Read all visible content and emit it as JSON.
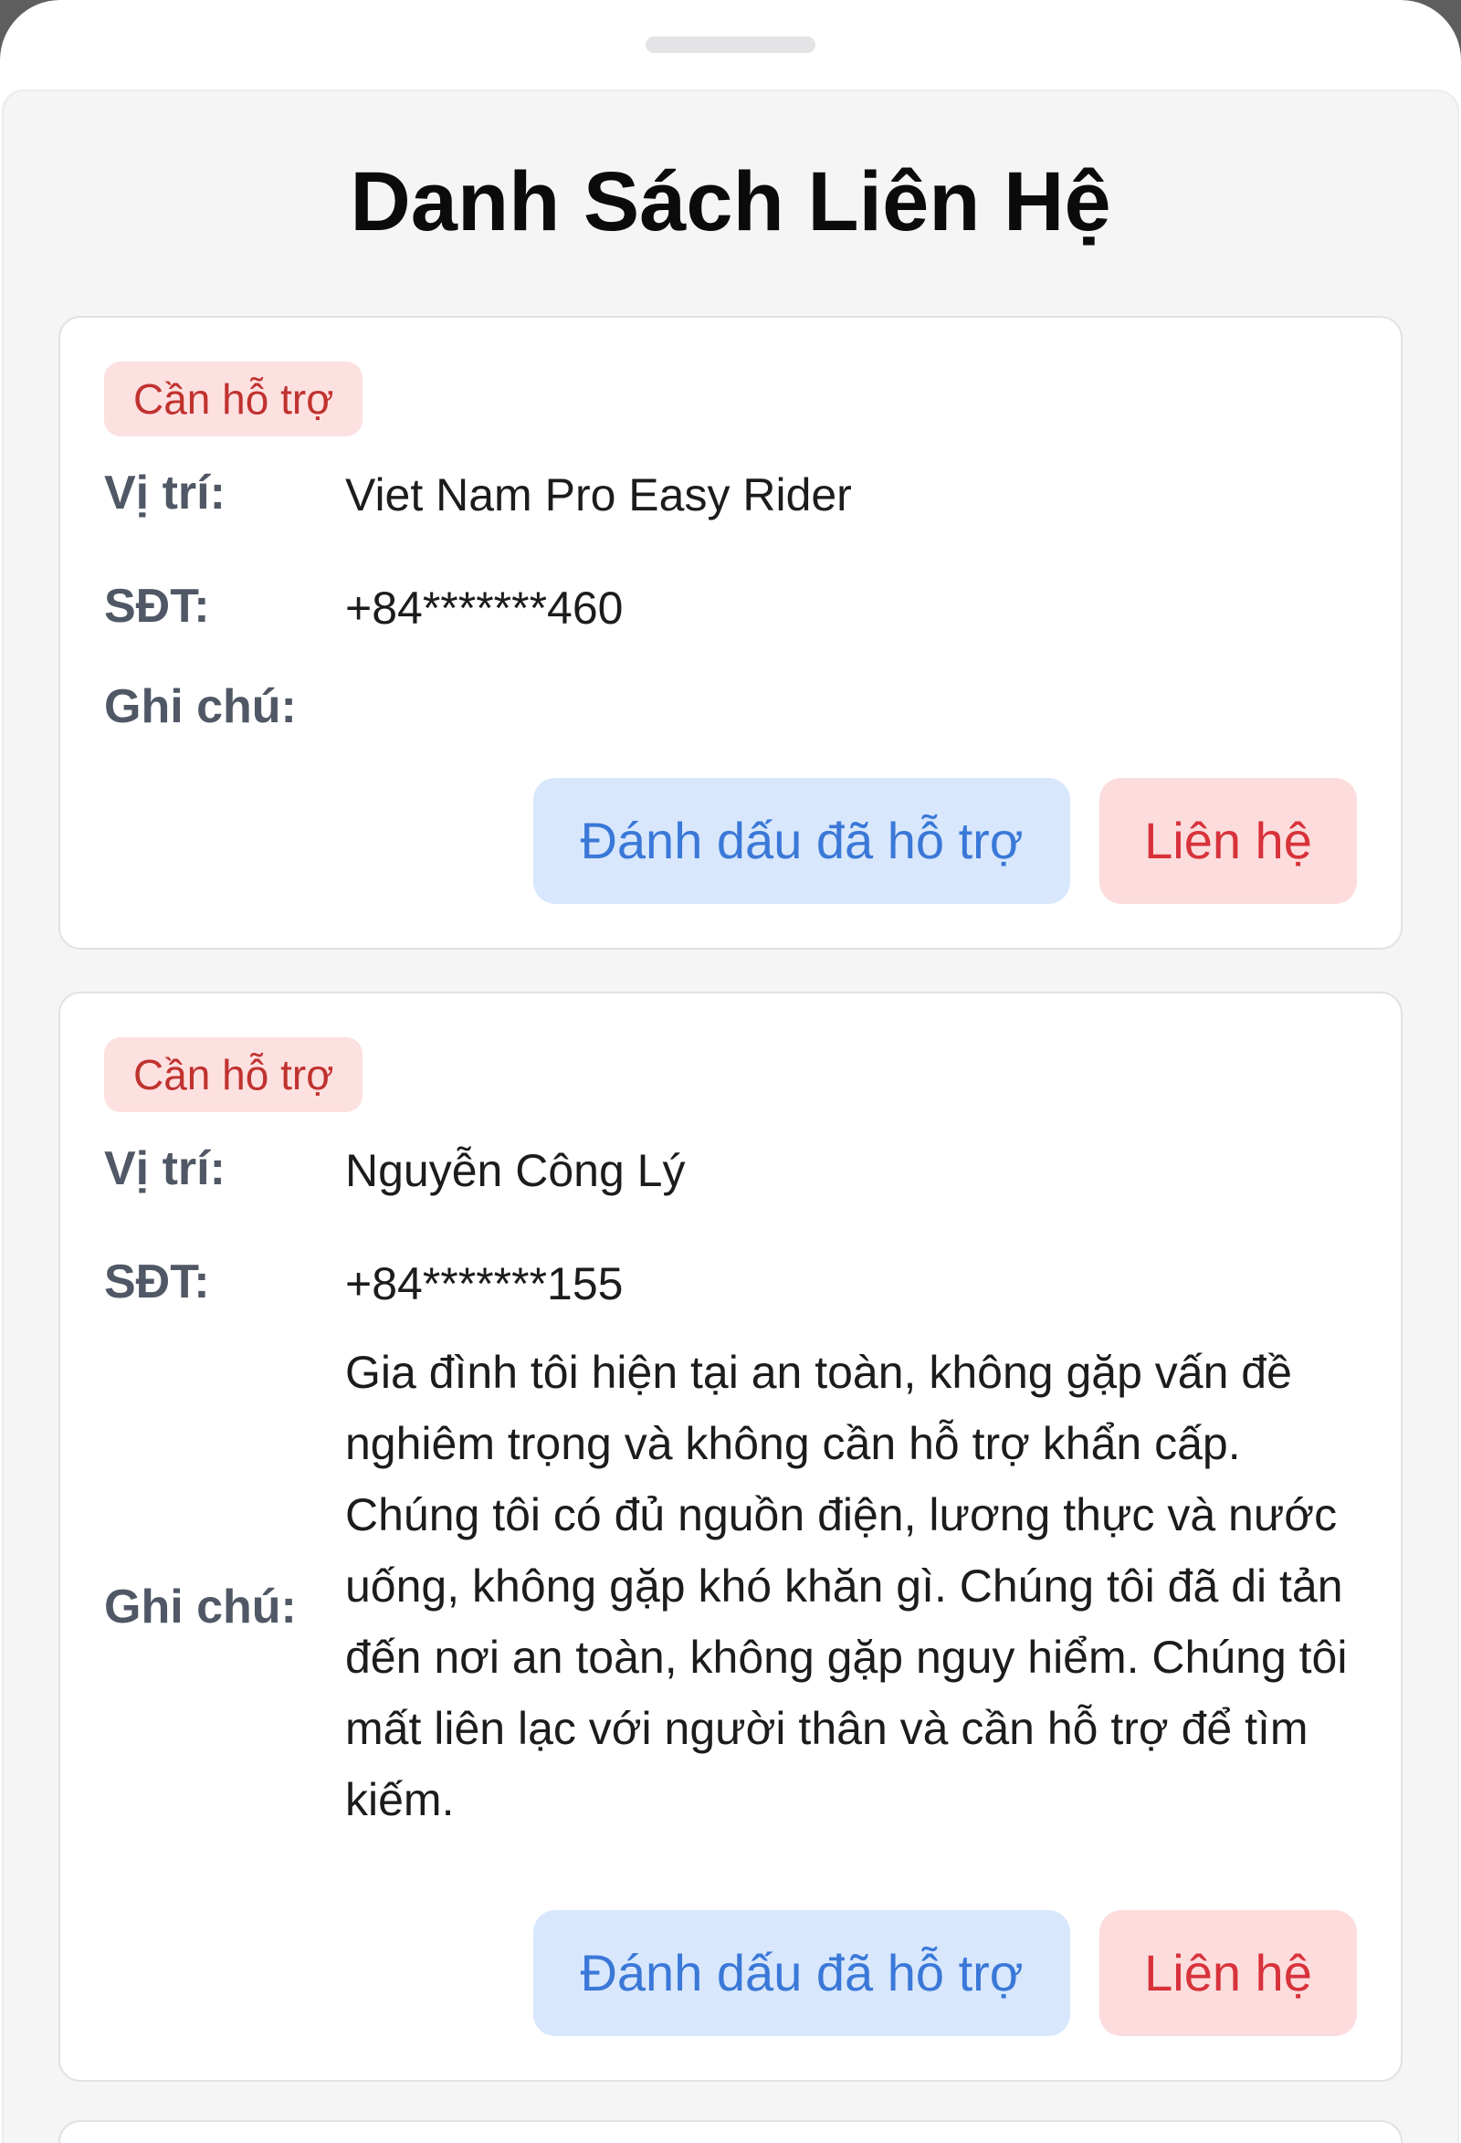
{
  "page": {
    "title": "Danh Sách Liên Hệ"
  },
  "labels": {
    "location": "Vị trí:",
    "phone": "SĐT:",
    "note": "Ghi chú:",
    "mark_button": "Đánh dấu đã hỗ trợ",
    "contact_button": "Liên hệ"
  },
  "contacts": [
    {
      "status": "Cần hỗ trợ",
      "location": "Viet Nam Pro Easy Rider",
      "phone": "+84*******460",
      "note": ""
    },
    {
      "status": "Cần hỗ trợ",
      "location": "Nguyễn Công Lý",
      "phone": "+84*******155",
      "note": "Gia đình tôi hiện tại an toàn, không gặp vấn đề nghiêm trọng và không cần hỗ trợ khẩn cấp. Chúng tôi có đủ nguồn điện, lương thực và nước uống, không gặp khó khăn gì. Chúng tôi đã di tản đến nơi an toàn, không gặp nguy hiểm. Chúng tôi mất liên lạc với người thân và cần hỗ trợ để tìm kiếm."
    }
  ],
  "colors": {
    "badge_bg": "#fde0e0",
    "badge_text": "#c0322f",
    "mark_button_bg": "#d8e7fc",
    "mark_button_text": "#3a78d8",
    "contact_button_bg": "#fcdcdc",
    "contact_button_text": "#d8323a"
  }
}
